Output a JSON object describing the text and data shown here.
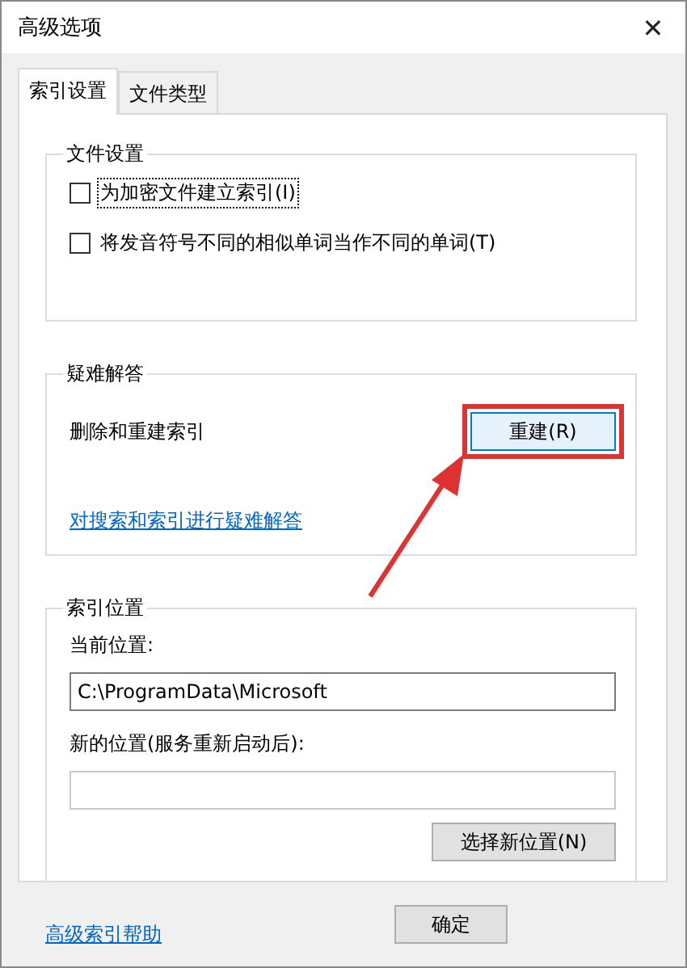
{
  "window": {
    "title": "高级选项",
    "close": "✕"
  },
  "tabs": [
    {
      "label": "索引设置",
      "selected": true
    },
    {
      "label": "文件类型",
      "selected": false
    }
  ],
  "file_settings": {
    "title": "文件设置",
    "options": [
      {
        "label": "为加密文件建立索引(I)",
        "checked": false,
        "focused": true
      },
      {
        "label": "将发音符号不同的相似单词当作不同的单词(T)",
        "checked": false,
        "focused": false
      }
    ]
  },
  "troubleshooting": {
    "title": "疑难解答",
    "description": "删除和重建索引",
    "button": "重建(R)",
    "highlighted": true,
    "link": "对搜索和索引进行疑难解答"
  },
  "index_location": {
    "title": "索引位置",
    "current_label": "当前位置:",
    "current_value": "C:\\ProgramData\\Microsoft",
    "new_label": "新的位置(服务重新启动后):",
    "button": "选择新位置(N)"
  },
  "help_link": "高级索引帮助",
  "buttons": [
    "确定"
  ]
}
